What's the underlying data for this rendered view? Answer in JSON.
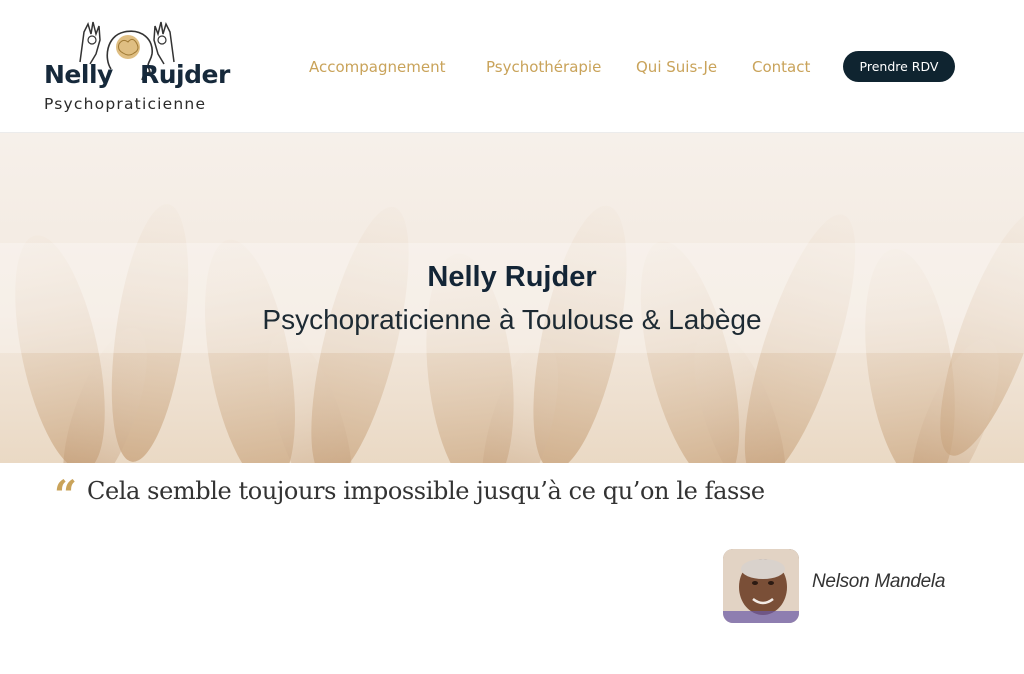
{
  "brand": {
    "first_name": "Nelly",
    "last_name": "Rujder",
    "tagline": "Psychopraticienne"
  },
  "nav": {
    "items": [
      {
        "label": "Accompagnement"
      },
      {
        "label": "Psychothérapie"
      },
      {
        "label": "Qui Suis-Je"
      },
      {
        "label": "Contact"
      }
    ],
    "cta_label": "Prendre RDV"
  },
  "hero": {
    "title": "Nelly Rujder",
    "subtitle": "Psychopraticienne à Toulouse & Labège"
  },
  "quote": {
    "text": "Cela semble toujours impossible jusqu’à ce qu’on le fasse",
    "author": "Nelson Mandela"
  },
  "colors": {
    "accent": "#c9a35a",
    "brand_dark": "#16293b",
    "cta_bg": "#0f2430"
  },
  "icons": {
    "logo": "brain-hands-logo",
    "quote": "quote-mark-icon"
  }
}
